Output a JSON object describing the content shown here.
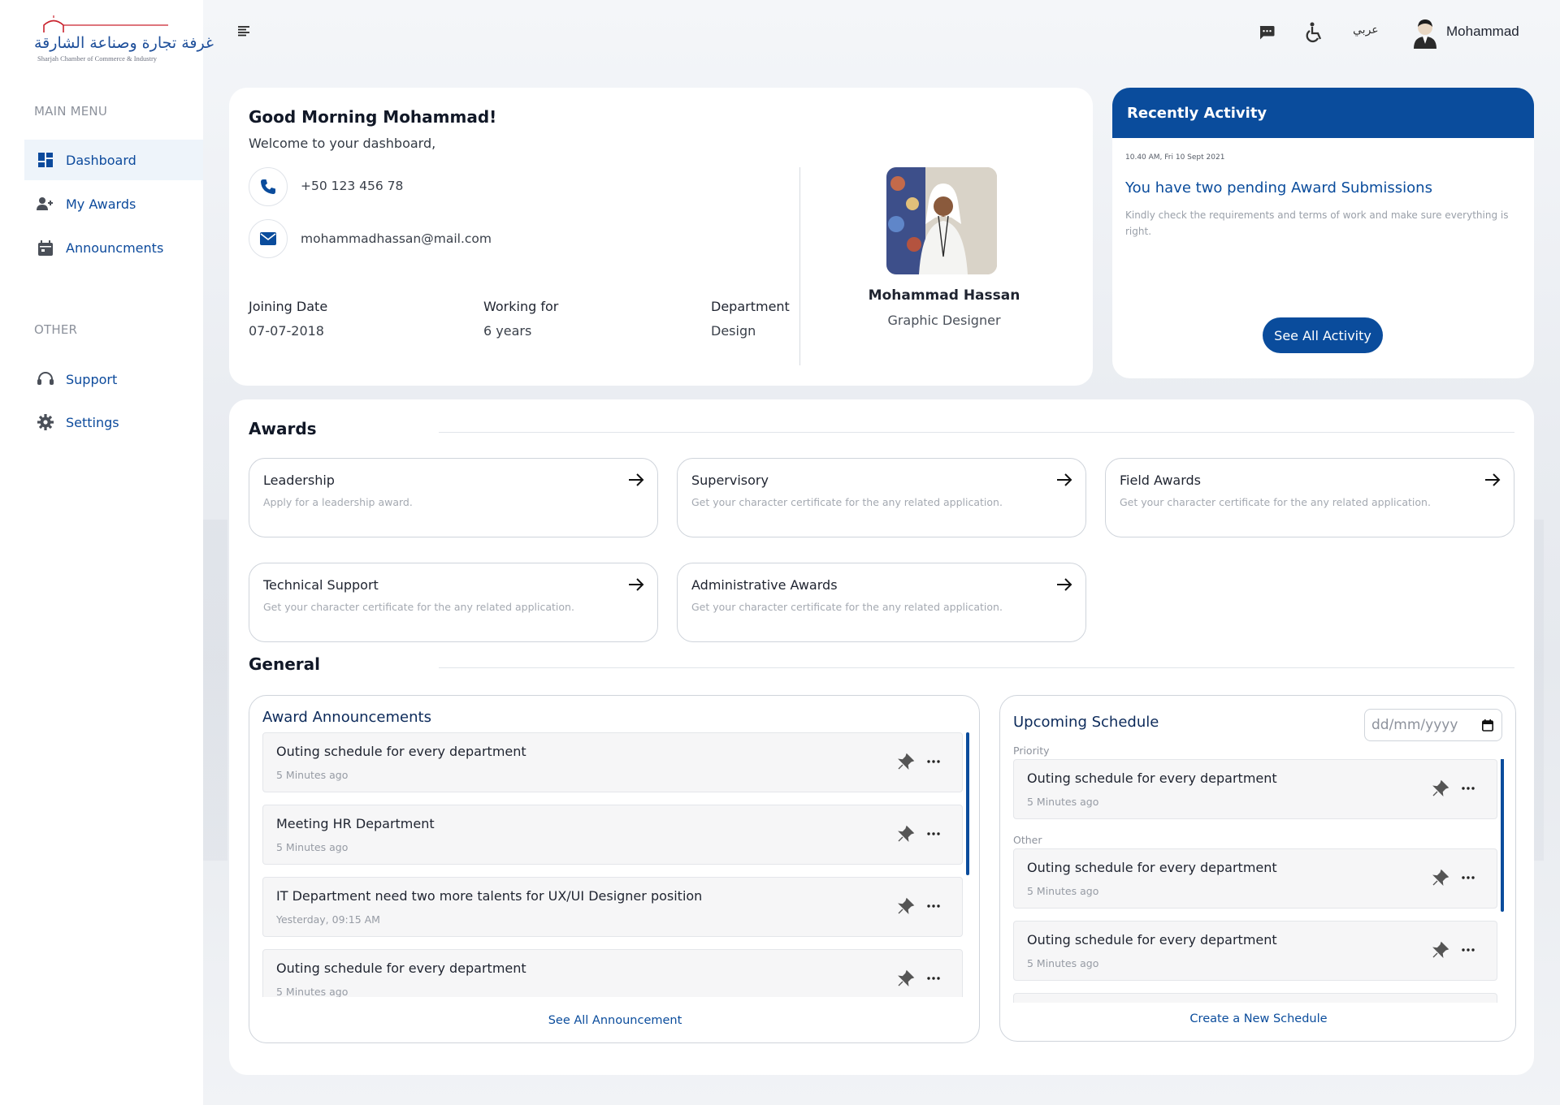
{
  "logo": {
    "arabic": "غرفة تجارة وصناعة الشارقة",
    "english": "Sharjah Chamber of Commerce & Industry"
  },
  "sidebar": {
    "main_heading": "MAIN MENU",
    "main_items": [
      {
        "label": "Dashboard",
        "icon": "dashboard-icon",
        "active": true
      },
      {
        "label": "My Awards",
        "icon": "user-plus-icon",
        "active": false
      },
      {
        "label": "Announcments",
        "icon": "calendar-icon",
        "active": false
      }
    ],
    "other_heading": "OTHER",
    "other_items": [
      {
        "label": "Support",
        "icon": "headset-icon"
      },
      {
        "label": "Settings",
        "icon": "gear-icon"
      }
    ]
  },
  "topbar": {
    "language": "عربي",
    "user_name": "Mohammad"
  },
  "welcome": {
    "greeting": "Good Morning Mohammad!",
    "subtitle": "Welcome to your dashboard,",
    "phone": "+50 123 456 78",
    "email": "mohammadhassan@mail.com",
    "info": [
      {
        "label": "Joining Date",
        "value": "07-07-2018"
      },
      {
        "label": "Working for",
        "value": "6 years"
      },
      {
        "label": "Department",
        "value": "Design"
      }
    ],
    "profile_name": "Mohammad Hassan",
    "profile_role": "Graphic Designer"
  },
  "activity": {
    "title": "Recently Activity",
    "time": "10.40 AM, Fri 10 Sept 2021",
    "headline": "You have two pending Award Submissions",
    "description": "Kindly check the requirements and terms of work and make sure everything is right.",
    "button": "See All Activity"
  },
  "awards": {
    "title": "Awards",
    "items": [
      {
        "title": "Leadership",
        "desc": "Apply for a leadership award."
      },
      {
        "title": "Supervisory",
        "desc": "Get your character certificate for the any related application."
      },
      {
        "title": "Field Awards",
        "desc": "Get your character certificate for the any related application."
      },
      {
        "title": "Technical Support",
        "desc": "Get your character certificate for the any related application."
      },
      {
        "title": "Administrative Awards",
        "desc": "Get your character certificate for the any related application."
      }
    ]
  },
  "general": {
    "title": "General",
    "announcements": {
      "title": "Award Announcements",
      "items": [
        {
          "title": "Outing schedule for every department",
          "time": "5 Minutes ago"
        },
        {
          "title": "Meeting HR Department",
          "time": "5 Minutes ago"
        },
        {
          "title": "IT Department need two more talents for UX/UI Designer position",
          "time": "Yesterday, 09:15 AM"
        },
        {
          "title": "Outing schedule for every department",
          "time": "5 Minutes ago"
        }
      ],
      "link": "See All Announcement"
    },
    "schedule": {
      "title": "Upcoming Schedule",
      "date_placeholder": "dd/mm/yyyy",
      "priority_label": "Priority",
      "other_label": "Other",
      "items": [
        {
          "title": "Outing schedule for every department",
          "time": "5 Minutes ago"
        },
        {
          "title": "Outing schedule for every department",
          "time": "5 Minutes ago"
        },
        {
          "title": "Outing schedule for every department",
          "time": "5 Minutes ago"
        }
      ],
      "link": "Create a New Schedule"
    }
  },
  "colors": {
    "primary": "#0a4c9c",
    "background": "#eef1f6",
    "card": "#ffffff"
  }
}
